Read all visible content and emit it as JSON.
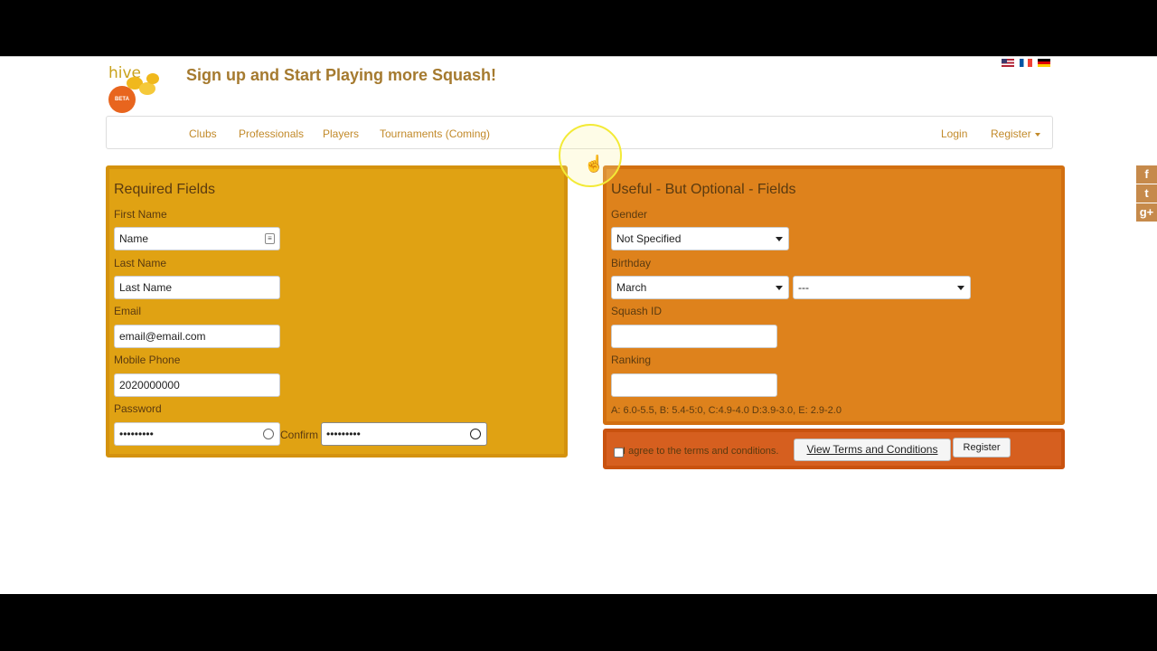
{
  "header": {
    "logo_text": "hive",
    "logo_badge": "BETA",
    "title": "Sign up and Start Playing more Squash!"
  },
  "flags": [
    "us-flag-icon",
    "fr-flag-icon",
    "de-flag-icon"
  ],
  "nav": {
    "items": [
      "Clubs",
      "Professionals",
      "Players",
      "Tournaments (Coming)"
    ],
    "login": "Login",
    "register": "Register"
  },
  "required": {
    "title": "Required Fields",
    "first_name_label": "First Name",
    "first_name_value": "Name",
    "last_name_label": "Last Name",
    "last_name_value": "Last Name",
    "email_label": "Email",
    "email_value": "email@email.com",
    "phone_label": "Mobile Phone",
    "phone_value": "2020000000",
    "password_label": "Password",
    "password_value": "•••••••••",
    "confirm_label": "Confirm",
    "confirm_value": "•••••••••"
  },
  "optional": {
    "title": "Useful - But Optional - Fields",
    "gender_label": "Gender",
    "gender_value": "Not Specified",
    "birthday_label": "Birthday",
    "birthday_month": "March",
    "birthday_year": "---",
    "squash_id_label": "Squash ID",
    "squash_id_value": "",
    "ranking_label": "Ranking",
    "ranking_value": "",
    "ranking_hint": "A: 6.0-5.5, B: 5.4-5:0, C:4.9-4.0 D:3.9-3.0, E: 2.9-2.0"
  },
  "terms": {
    "agree_text": "I agree to the terms and conditions.",
    "view_button": "View Terms and Conditions",
    "register_button": "Register"
  },
  "social": [
    "f",
    "t",
    "g+"
  ],
  "colors": {
    "required_panel": "#e0a213",
    "optional_panel": "#de821c",
    "terms_panel": "#d65f1f",
    "nav_link": "#c28a2a",
    "title": "#a57a2f"
  }
}
